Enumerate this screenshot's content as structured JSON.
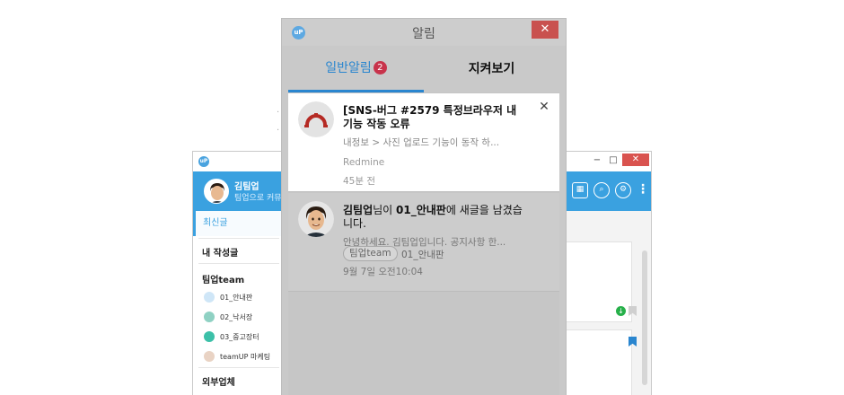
{
  "popup": {
    "title": "알림",
    "close_icon": "close-icon",
    "tabs": {
      "general_label": "일반알림",
      "general_badge": "2",
      "watch_label": "지켜보기"
    },
    "notifications": [
      {
        "icon": "redmine-logo",
        "title": "[SNS-버그 #2579 특정브라우저 내 기능 작동 오류",
        "snippet": "내정보 > 사진 업로드 기능이 동작 하...",
        "source": "Redmine",
        "time": "45분 전"
      },
      {
        "icon": "user-avatar",
        "title_name": "김팀업",
        "title_mid": "님이 ",
        "title_board": "01_안내판",
        "title_tail": "에 새글을 남겼습니다.",
        "snippet": "안녕하세요. 김팀업입니다. 공지사항 한...",
        "tag": "팀업team",
        "board": "01_안내판",
        "time": "9월 7일 오전10:04"
      }
    ]
  },
  "app": {
    "user_name": "김팀업",
    "subtitle": "팀업으로 커뮤",
    "sidebar": {
      "latest": "최신글",
      "my_posts": "내 작성글",
      "team_section": "팀업team",
      "items": [
        "01_안내판",
        "02_낙서장",
        "03_중고장터",
        "teamUP 마케팅"
      ],
      "external_section": "외부업체"
    },
    "window_buttons": [
      "−",
      "□",
      "✕"
    ],
    "colors": {
      "header": "#3aa1e0",
      "accent": "#2a86cf",
      "badge": "#c8334b",
      "close": "#d9534f"
    }
  }
}
